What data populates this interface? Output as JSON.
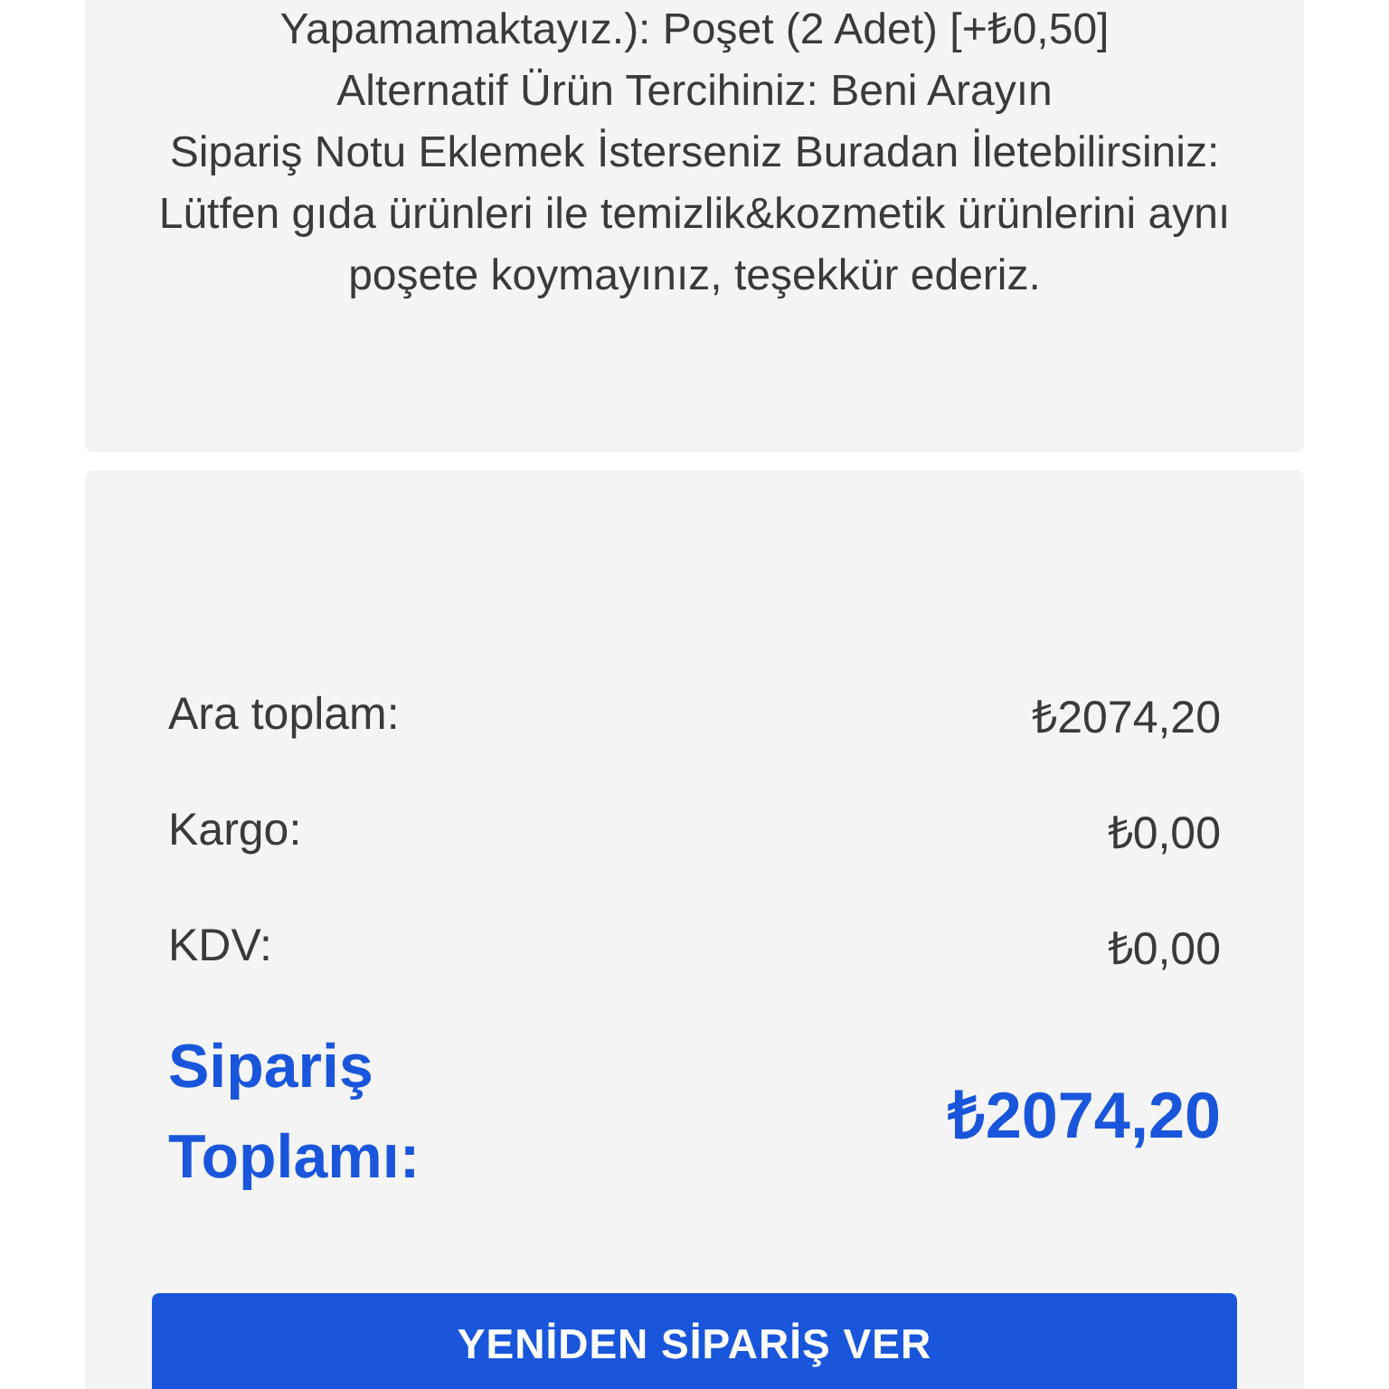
{
  "note_card": {
    "lines": [
      "Yapamamaktayız.): Poşet (2 Adet) [+₺0,50]",
      "Alternatif Ürün Tercihiniz: Beni Arayın",
      "Sipariş Notu Eklemek İsterseniz Buradan İletebilirsiniz: Lütfen gıda ürünleri ile temizlik&kozmetik ürünlerini aynı poşete koymayınız, teşekkür ederiz."
    ]
  },
  "summary": {
    "rows": [
      {
        "label": "Ara toplam:",
        "value": "₺2074,20"
      },
      {
        "label": "Kargo:",
        "value": "₺0,00"
      },
      {
        "label": "KDV:",
        "value": "₺0,00"
      }
    ],
    "total": {
      "label": "Sipariş Toplamı:",
      "value": "₺2074,20"
    }
  },
  "button": "YENİDEN SİPARİŞ VER"
}
